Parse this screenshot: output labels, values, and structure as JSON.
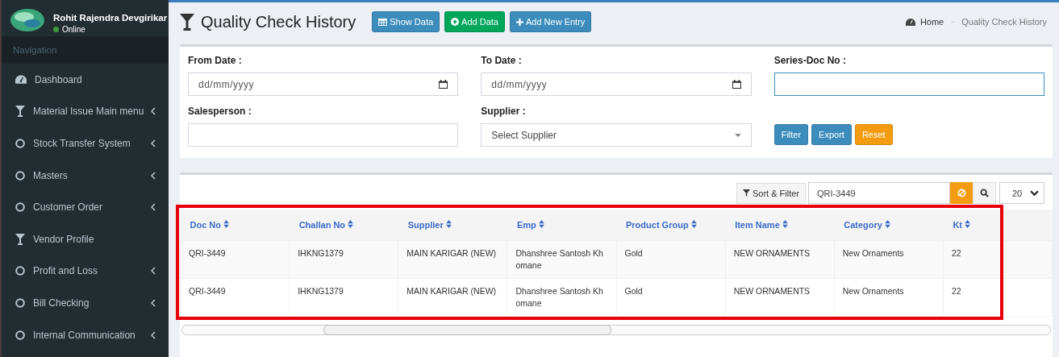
{
  "user": {
    "name": "Rohit Rajendra Devgirikar",
    "status": "Online"
  },
  "sidebar": {
    "header": "Navigation",
    "items": [
      {
        "label": "Dashboard",
        "kind": "dashboard",
        "has_submenu": false
      },
      {
        "label": "Material Issue Main menu",
        "kind": "filter",
        "has_submenu": true
      },
      {
        "label": "Stock Transfer System",
        "kind": "circle",
        "has_submenu": true
      },
      {
        "label": "Masters",
        "kind": "circle",
        "has_submenu": true
      },
      {
        "label": "Customer Order",
        "kind": "circle",
        "has_submenu": true
      },
      {
        "label": "Vendor Profile",
        "kind": "filter",
        "has_submenu": false
      },
      {
        "label": "Profit and Loss",
        "kind": "circle",
        "has_submenu": true
      },
      {
        "label": "Bill Checking",
        "kind": "circle",
        "has_submenu": true
      },
      {
        "label": "Internal Communication",
        "kind": "circle",
        "has_submenu": true
      }
    ]
  },
  "page": {
    "title": "Quality Check History",
    "buttons": [
      {
        "label": "Show Data",
        "kind": "table",
        "color": "#3c8dbc"
      },
      {
        "label": "Add Data",
        "kind": "plus-circle",
        "color": "#00a65a"
      },
      {
        "label": "Add New Entry",
        "kind": "plus",
        "color": "#3c8dbc"
      }
    ],
    "breadcrumb": [
      "Home",
      "Quality Check History"
    ]
  },
  "filters": {
    "fields": [
      {
        "label": "From Date :",
        "kind": "date",
        "placeholder": "dd/mm/yyyy"
      },
      {
        "label": "To Date :",
        "kind": "date",
        "placeholder": "dd/mm/yyyy"
      },
      {
        "label": "Series-Doc No :",
        "kind": "text",
        "focused": true
      },
      {
        "label": "Salesperson :",
        "kind": "text",
        "focused": false
      },
      {
        "label": "Supplier :",
        "kind": "select",
        "value": "Select Supplier"
      }
    ],
    "buttons": [
      {
        "label": "Filter",
        "color": "#3c8dbc"
      },
      {
        "label": "Export",
        "color": "#3c8dbc"
      },
      {
        "label": "Reset",
        "color": "#f39c12"
      }
    ]
  },
  "table": {
    "sort_filter": "Sort & Filter",
    "search": "QRI-3449",
    "page_size": "20",
    "columns": [
      "Doc No",
      "Challan No",
      "Supplier",
      "Emp",
      "Product Group",
      "Item Name",
      "Category",
      "Kt"
    ],
    "rows": [
      [
        "QRI-3449",
        "IHKNG1379",
        "MAIN KARIGAR (NEW)",
        "Dhanshree Santosh Khomane",
        "Gold",
        "NEW ORNAMENTS",
        "New Ornaments",
        "22"
      ],
      [
        "QRI-3449",
        "IHKNG1379",
        "MAIN KARIGAR (NEW)",
        "Dhanshree Santosh Khomane",
        "Gold",
        "NEW ORNAMENTS",
        "New Ornaments",
        "22"
      ]
    ]
  }
}
